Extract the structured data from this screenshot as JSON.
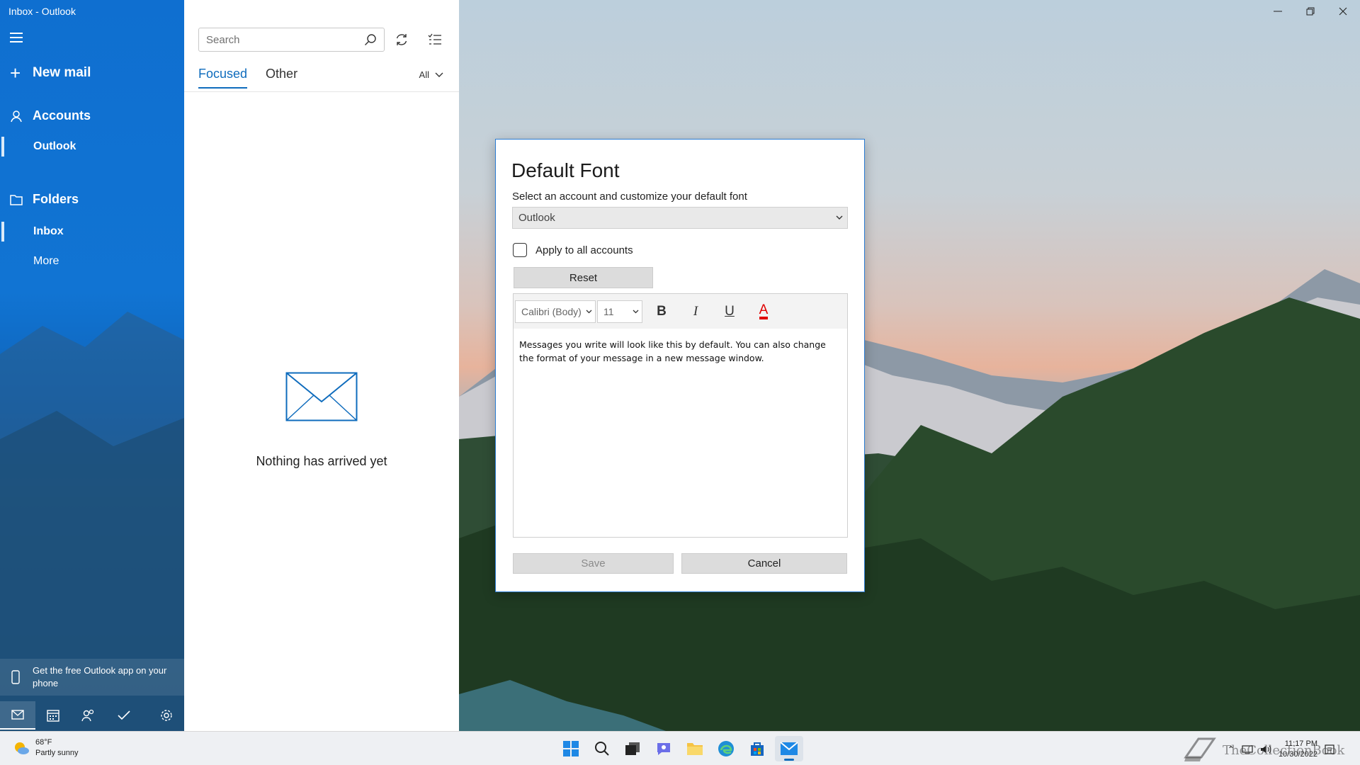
{
  "window": {
    "title": "Inbox - Outlook"
  },
  "sidebar": {
    "new_mail": "New mail",
    "accounts_label": "Accounts",
    "account_item": "Outlook",
    "folders_label": "Folders",
    "inbox_item": "Inbox",
    "more_item": "More",
    "promo": "Get the free Outlook app on your phone"
  },
  "bottom_nav": [
    "mail-icon",
    "calendar-icon",
    "people-icon",
    "todo-icon",
    "settings-icon"
  ],
  "message_list": {
    "search_placeholder": "Search",
    "tabs": [
      "Focused",
      "Other"
    ],
    "filter": "All",
    "empty_text": "Nothing has arrived yet"
  },
  "dialog": {
    "title": "Default Font",
    "subtitle": "Select an account and customize your default font",
    "account_select": "Outlook",
    "apply_all": "Apply to all accounts",
    "reset": "Reset",
    "font_family": "Calibri (Body)",
    "font_size": "11",
    "bold": "B",
    "italic": "I",
    "underline": "U",
    "font_color": "A",
    "preview_text": "Messages you write will look like this by default. You can also change the format of your message in a new message window.",
    "save": "Save",
    "cancel": "Cancel"
  },
  "taskbar": {
    "temperature": "68°F",
    "condition": "Partly sunny",
    "time": "11:17 PM",
    "date": "10/30/2022",
    "watermark": "TheCollectionBook"
  },
  "colors": {
    "accent": "#0f6cbd",
    "sidebar": "#1174d3",
    "font_color_red": "#e00000"
  }
}
